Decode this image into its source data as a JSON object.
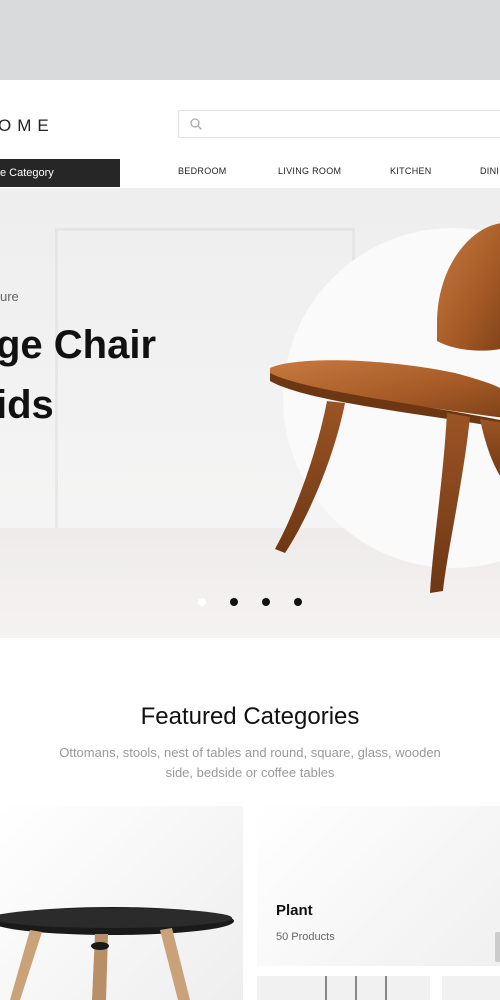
{
  "brand": {
    "logo_text": "OME"
  },
  "search": {
    "placeholder": ""
  },
  "header": {
    "category_button": "e Category",
    "nav": [
      "BEDROOM",
      "LIVING ROOM",
      "KITCHEN",
      "DINI"
    ]
  },
  "hero": {
    "eyebrow": "ure",
    "title_line1": "ge Chair",
    "title_line2": "ids",
    "slides": 4,
    "active_slide": 1
  },
  "featured": {
    "title": "Featured Categories",
    "subtitle": "Ottomans, stools, nest of tables and round, square, glass, wooden side, bedside or coffee tables"
  },
  "cards": [
    {
      "name": "Plant",
      "count": "50 Products"
    }
  ],
  "colors": {
    "dark": "#262626",
    "wood": "#a8602e",
    "background": "#ffffff"
  },
  "icons": {
    "search": "search-icon"
  }
}
